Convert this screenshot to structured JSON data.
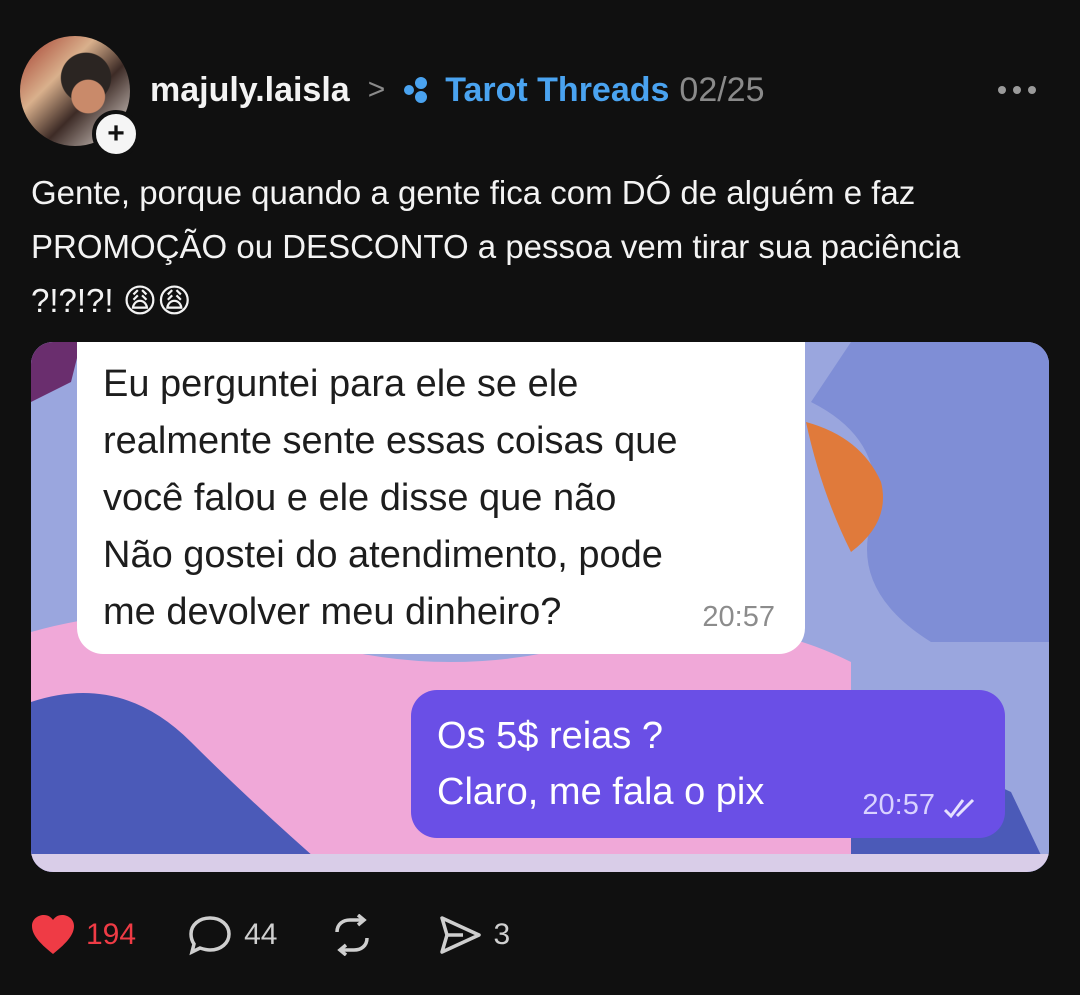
{
  "post": {
    "username": "majuly.laisla",
    "community": "Tarot Threads",
    "date": "02/25",
    "text": "Gente, porque quando a gente fica com DÓ de alguém e faz PROMOÇÃO ou DESCONTO a pessoa vem tirar sua paciência ?!?!?! 😩😩"
  },
  "chat": {
    "incoming": {
      "text": "Eu perguntei para ele se ele\nrealmente sente essas coisas que\nvocê falou e ele disse que não\nNão gostei do atendimento, pode\nme devolver meu dinheiro?",
      "time": "20:57"
    },
    "outgoing": {
      "text": "Os 5$ reias ?\nClaro, me fala o pix",
      "time": "20:57"
    }
  },
  "actions": {
    "likes": "194",
    "comments": "44",
    "shares": "3"
  },
  "colors": {
    "like": "#ef3b45",
    "community": "#4aa3f0",
    "outgoing_bubble": "#6a4fe6"
  }
}
